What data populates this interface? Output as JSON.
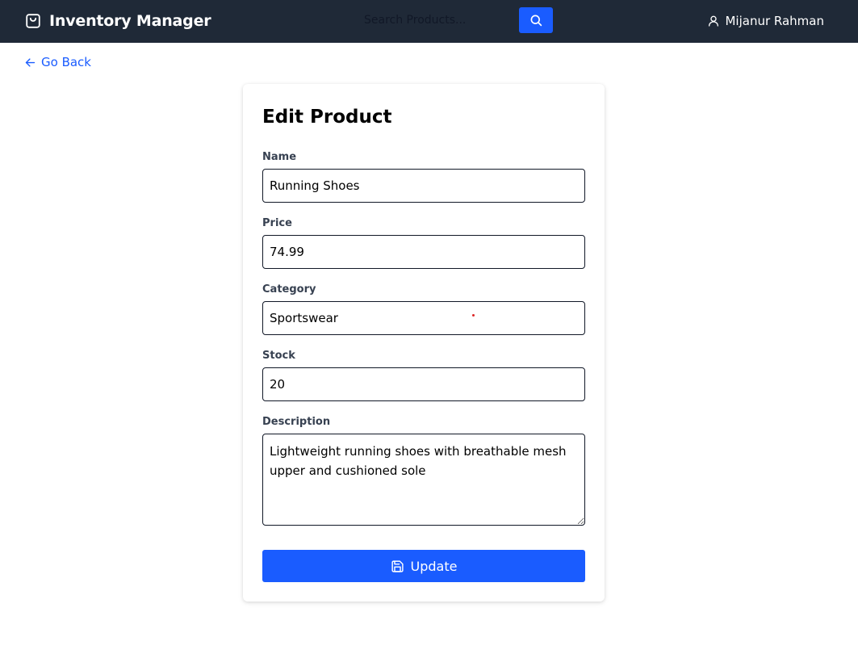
{
  "app": {
    "title": "Inventory Manager",
    "brand_icon": "shopping-bag-icon"
  },
  "search": {
    "placeholder": "Search Products...",
    "button_icon": "search-icon"
  },
  "user": {
    "name": "Mijanur Rahman",
    "icon": "user-icon"
  },
  "nav": {
    "go_back_label": "Go Back",
    "go_back_icon": "arrow-left-icon"
  },
  "form": {
    "title": "Edit Product",
    "fields": {
      "name": {
        "label": "Name",
        "value": "Running Shoes"
      },
      "price": {
        "label": "Price",
        "value": "74.99"
      },
      "category": {
        "label": "Category",
        "value": "Sportswear"
      },
      "stock": {
        "label": "Stock",
        "value": "20"
      },
      "description": {
        "label": "Description",
        "value": "Lightweight running shoes with breathable mesh upper and cushioned sole"
      }
    },
    "submit_label": "Update",
    "submit_icon": "save-icon"
  },
  "colors": {
    "navbar_bg": "#1f2937",
    "accent": "#1a5cff",
    "card_bg": "#ffffff"
  }
}
